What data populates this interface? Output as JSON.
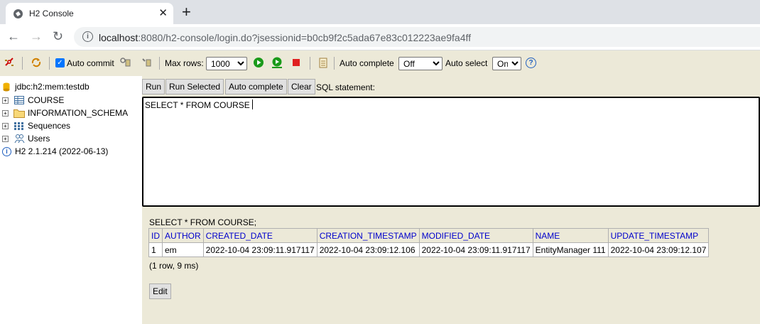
{
  "browser": {
    "tab_title": "H2 Console",
    "url_host": "localhost",
    "url_rest": ":8080/h2-console/login.do?jsessionid=b0cb9f2c5ada67e83c012223ae9fa4ff"
  },
  "toolbar": {
    "auto_commit_label": "Auto commit",
    "max_rows_label": "Max rows:",
    "max_rows_value": "1000",
    "auto_complete_label": "Auto complete",
    "auto_complete_value": "Off",
    "auto_select_label": "Auto select",
    "auto_select_value": "On",
    "help_icon": "?"
  },
  "tree": {
    "connection": "jdbc:h2:mem:testdb",
    "items": [
      "COURSE",
      "INFORMATION_SCHEMA",
      "Sequences",
      "Users"
    ],
    "version": "H2 2.1.214 (2022-06-13)"
  },
  "main": {
    "buttons": [
      "Run",
      "Run Selected",
      "Auto complete",
      "Clear"
    ],
    "sql_label": "SQL statement:",
    "sql_text": "SELECT * FROM COURSE",
    "result_statement": "SELECT * FROM COURSE;",
    "columns": [
      "ID",
      "AUTHOR",
      "CREATED_DATE",
      "CREATION_TIMESTAMP",
      "MODIFIED_DATE",
      "NAME",
      "UPDATE_TIMESTAMP"
    ],
    "rows": [
      [
        "1",
        "em",
        "2022-10-04 23:09:11.917117",
        "2022-10-04 23:09:12.106",
        "2022-10-04 23:09:11.917117",
        "EntityManager 111",
        "2022-10-04 23:09:12.107"
      ]
    ],
    "row_count": "(1 row, 9 ms)",
    "edit_label": "Edit"
  }
}
